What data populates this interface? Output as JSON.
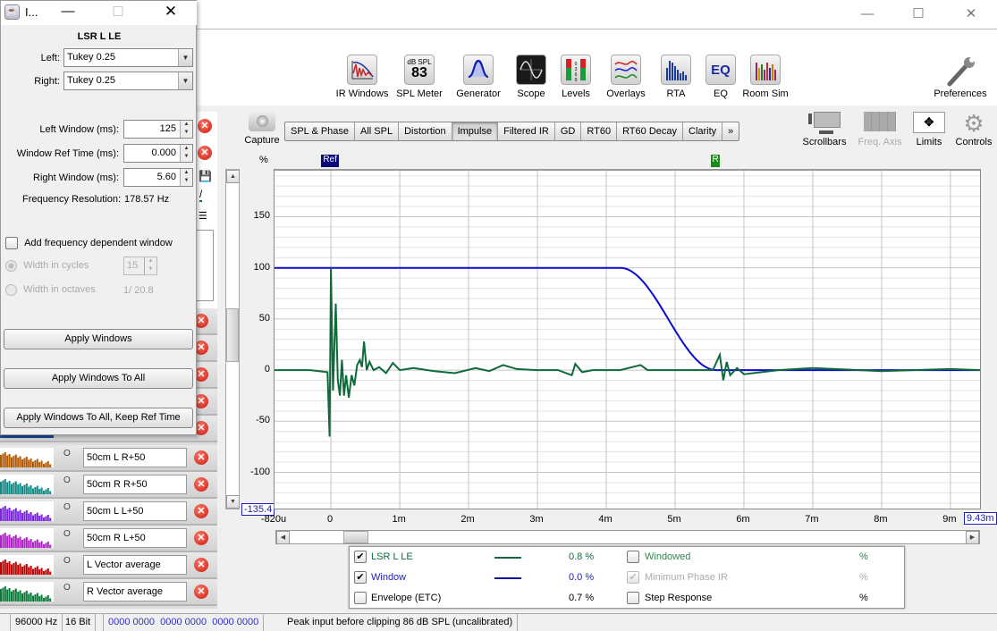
{
  "main_window": {
    "controls": {
      "minimize": "—",
      "maximize": "☐",
      "close": "✕"
    }
  },
  "toolbar": {
    "tools": [
      {
        "label": "IR Windows",
        "icon": "ir-windows-icon"
      },
      {
        "label": "SPL Meter",
        "icon": "spl-meter-icon",
        "meter_label": "dB SPL",
        "meter_value": "83"
      },
      {
        "label": "Generator",
        "icon": "generator-icon"
      },
      {
        "label": "Scope",
        "icon": "scope-icon"
      },
      {
        "label": "Levels",
        "icon": "levels-icon",
        "level_digits": "0\n3\n6\n9"
      },
      {
        "label": "Overlays",
        "icon": "overlays-icon"
      },
      {
        "label": "RTA",
        "icon": "rta-icon"
      },
      {
        "label": "EQ",
        "icon": "eq-icon",
        "glyph": "EQ"
      },
      {
        "label": "Room Sim",
        "icon": "room-sim-icon"
      }
    ],
    "preferences": "Preferences",
    "capture": "Capture",
    "scrollbars": "Scrollbars",
    "freq_axis": "Freq. Axis",
    "limits": "Limits",
    "controls": "Controls"
  },
  "tabs": [
    {
      "label": "SPL & Phase",
      "active": false
    },
    {
      "label": "All SPL",
      "active": false
    },
    {
      "label": "Distortion",
      "active": false
    },
    {
      "label": "Impulse",
      "active": true
    },
    {
      "label": "Filtered IR",
      "active": false
    },
    {
      "label": "GD",
      "active": false
    },
    {
      "label": "RT60",
      "active": false
    },
    {
      "label": "RT60 Decay",
      "active": false
    },
    {
      "label": "Clarity",
      "active": false
    },
    {
      "label": "»",
      "active": false
    }
  ],
  "dialog": {
    "title": "I...",
    "measurement": "LSR L LE",
    "left_label": "Left:",
    "left_value": "Tukey 0.25",
    "right_label": "Right:",
    "right_value": "Tukey 0.25",
    "left_window_label": "Left Window (ms):",
    "left_window_value": "125",
    "ref_time_label": "Window Ref Time (ms):",
    "ref_time_value": "0.000",
    "right_window_label": "Right Window (ms):",
    "right_window_value": "5.60",
    "freq_res_label": "Frequency Resolution:",
    "freq_res_value": "178.57 Hz",
    "add_freq_window": "Add frequency dependent window",
    "add_freq_window_checked": false,
    "width_cycles_label": "Width in cycles",
    "width_cycles_value": "15",
    "width_octaves_label": "Width in octaves",
    "width_octaves_value": "1/ 20.8",
    "apply_windows": "Apply Windows",
    "apply_windows_all": "Apply Windows To All",
    "apply_windows_all_keep": "Apply Windows To All, Keep Ref Time"
  },
  "measurements": [
    {
      "name": "50cm L R+50",
      "color": "#b35a00"
    },
    {
      "name": "50cm R R+50",
      "color": "#118a86"
    },
    {
      "name": "50cm L L+50",
      "color": "#7a22e6"
    },
    {
      "name": "50cm R L+50",
      "color": "#b020c8"
    },
    {
      "name": "L Vector average",
      "color": "#c00000"
    },
    {
      "name": "R Vector average",
      "color": "#0a7a3a"
    }
  ],
  "chart_data": {
    "type": "line",
    "ylabel": "%",
    "y_ticks": [
      "150",
      "100",
      "50",
      "0",
      "-50",
      "-100"
    ],
    "ylim": [
      -135.4,
      195
    ],
    "y_min_label": "-135.4",
    "x_ticks": [
      "-820u",
      "0",
      "1m",
      "2m",
      "3m",
      "4m",
      "5m",
      "6m",
      "7m",
      "8m",
      "9m"
    ],
    "x_max_label": "9.43m",
    "xlim_ms": [
      -0.82,
      9.43
    ],
    "grid": true,
    "markers": [
      {
        "label": "Ref",
        "x_ms": 0,
        "color": "#0a0a7a"
      },
      {
        "label": "R",
        "x_ms": 5.6,
        "color": "#1a8a1a"
      }
    ],
    "series": [
      {
        "name": "Window",
        "color": "#0a0ad0",
        "description": "flat at 100% to ~4.2ms, Tukey taper to 0 at 5.6ms"
      },
      {
        "name": "LSR L LE",
        "color": "#0e6a3a",
        "points_ms_pct": [
          [
            -0.82,
            0
          ],
          [
            -0.3,
            0
          ],
          [
            -0.05,
            -2
          ],
          [
            -0.02,
            -65
          ],
          [
            0.0,
            100
          ],
          [
            0.03,
            -20
          ],
          [
            0.07,
            65
          ],
          [
            0.1,
            -10
          ],
          [
            0.13,
            -25
          ],
          [
            0.16,
            10
          ],
          [
            0.19,
            -25
          ],
          [
            0.22,
            -5
          ],
          [
            0.26,
            -27
          ],
          [
            0.3,
            -5
          ],
          [
            0.34,
            -15
          ],
          [
            0.38,
            5
          ],
          [
            0.42,
            10
          ],
          [
            0.45,
            3
          ],
          [
            0.48,
            28
          ],
          [
            0.52,
            0
          ],
          [
            0.56,
            8
          ],
          [
            0.62,
            0
          ],
          [
            0.7,
            3
          ],
          [
            0.8,
            -3
          ],
          [
            0.9,
            7
          ],
          [
            1.0,
            0
          ],
          [
            1.2,
            2
          ],
          [
            1.5,
            -1
          ],
          [
            1.8,
            -3
          ],
          [
            2.1,
            2
          ],
          [
            2.3,
            -1
          ],
          [
            2.5,
            5
          ],
          [
            2.7,
            1
          ],
          [
            3.0,
            0
          ],
          [
            3.3,
            0
          ],
          [
            3.5,
            -5
          ],
          [
            3.55,
            6
          ],
          [
            3.65,
            -2
          ],
          [
            3.8,
            0
          ],
          [
            4.2,
            0
          ],
          [
            4.5,
            5
          ],
          [
            4.6,
            0
          ],
          [
            5.0,
            0
          ],
          [
            5.55,
            0
          ],
          [
            5.65,
            15
          ],
          [
            5.7,
            -10
          ],
          [
            5.75,
            8
          ],
          [
            5.8,
            -5
          ],
          [
            5.9,
            2
          ],
          [
            6.0,
            -4
          ],
          [
            6.5,
            0
          ],
          [
            7.0,
            2
          ],
          [
            8.0,
            -1
          ],
          [
            9.0,
            1
          ],
          [
            9.43,
            0
          ]
        ]
      }
    ]
  },
  "legend": {
    "rows": [
      {
        "label": "LSR L LE",
        "checked": true,
        "color": "#0e6a3a",
        "value": "0.8 %",
        "right_label": "Windowed",
        "right_checked": false,
        "right_value": "%",
        "right_color": "#2a8a4a",
        "right_disabled": false
      },
      {
        "label": "Window",
        "checked": true,
        "color": "#2020c0",
        "value": "0.0 %",
        "right_label": "Minimum Phase IR",
        "right_checked": true,
        "right_value": "%",
        "right_color": "#aaaaaa",
        "right_disabled": true
      },
      {
        "label": "Envelope (ETC)",
        "checked": false,
        "color": "#000000",
        "value": "0.7 %",
        "right_label": "Step Response",
        "right_checked": false,
        "right_value": "%",
        "right_color": "#000000",
        "right_disabled": false
      }
    ]
  },
  "status": {
    "sample_rate": "96000 Hz",
    "bits": "16 Bit",
    "levels": "0000 0000  0000 0000  0000 0000",
    "message": "Peak input before clipping 86 dB SPL (uncalibrated)"
  }
}
